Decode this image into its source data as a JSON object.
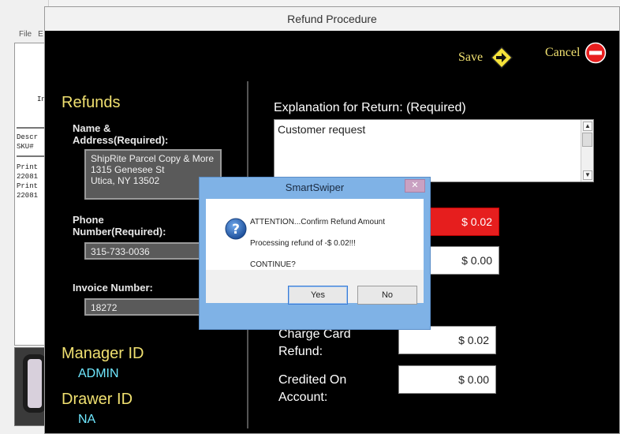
{
  "background_app": {
    "menu": [
      "File",
      "E"
    ],
    "text_lines": [
      {
        "text": "In"
      },
      {
        "text": "Descr"
      },
      {
        "text": "SKU#"
      },
      {
        "text": "Print"
      },
      {
        "text": "22081"
      },
      {
        "text": "Print"
      },
      {
        "text": "22081"
      }
    ]
  },
  "window": {
    "title": "Refund Procedure",
    "save_label": "Save",
    "cancel_label": "Cancel",
    "colors": {
      "accent_yellow": "#f0e070",
      "cyan": "#6fe8ff",
      "alert_red": "#e61e1e"
    }
  },
  "refunds": {
    "title": "Refunds",
    "name_label_1": "Name &",
    "name_label_2": "Address(Required):",
    "address_lines": [
      "ShipRite Parcel Copy & More",
      "1315 Genesee St",
      "Utica, NY 13502"
    ],
    "phone_label_1": "Phone",
    "phone_label_2": "Number(Required):",
    "phone": "315-733-0036",
    "invoice_label": "Invoice Number:",
    "invoice": "18272",
    "manager_title": "Manager ID",
    "manager_value": "ADMIN",
    "drawer_title": "Drawer ID",
    "drawer_value": "NA"
  },
  "explanation": {
    "label": "Explanation for Return:   (Required)",
    "value": "Customer request"
  },
  "amounts": {
    "total_refund": "$ 0.02",
    "other": "$ 0.00",
    "charge_card_label_1": "Charge Card",
    "charge_card_label_2": "Refund:",
    "charge_card": "$ 0.02",
    "credited_label_1": "Credited On",
    "credited_label_2": "Account:",
    "credited": "$ 0.00"
  },
  "dialog": {
    "title": "SmartSwiper",
    "close": "✕",
    "line1": "ATTENTION...Confirm Refund Amount",
    "line2": "Processing refund of -$ 0.02!!!",
    "line3": "CONTINUE?",
    "yes": "Yes",
    "no": "No",
    "icon": "question-icon"
  }
}
